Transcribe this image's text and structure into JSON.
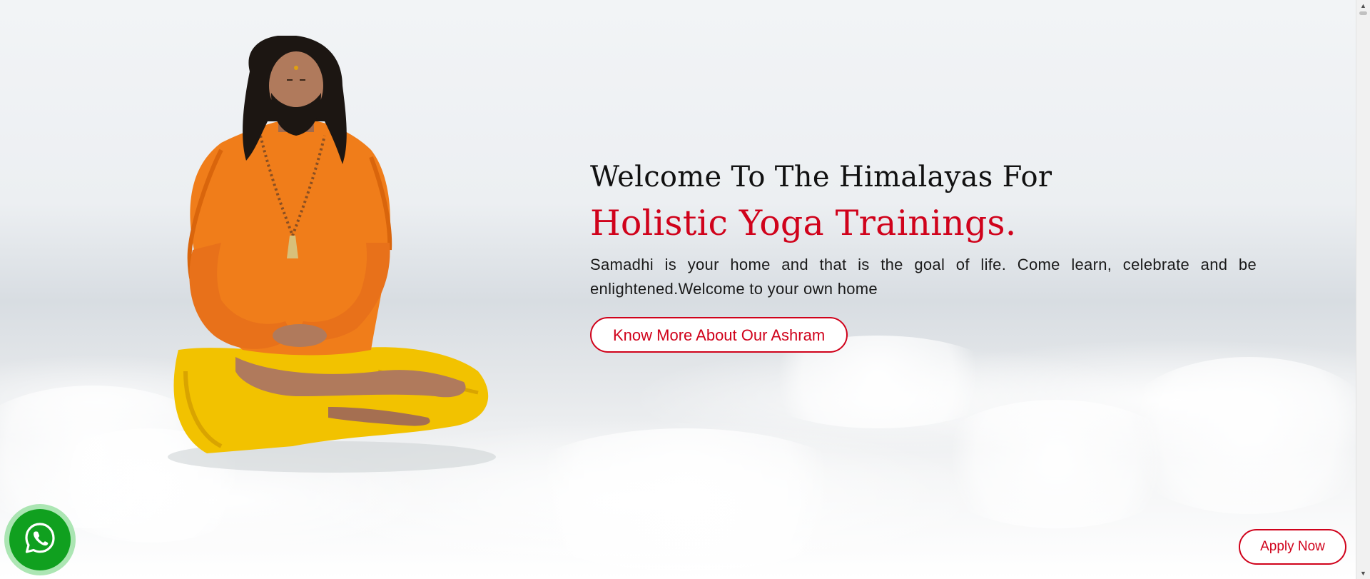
{
  "hero": {
    "welcome_text": "Welcome To The Himalayas For",
    "title_text": "Holistic Yoga Trainings.",
    "description": "Samadhi is your home and that is the goal of life. Come learn, celebrate and be enlightened.Welcome to your own home",
    "cta_label": "Know More About Our Ashram"
  },
  "floating": {
    "apply_label": "Apply Now",
    "whatsapp_icon": "whatsapp-icon"
  },
  "colors": {
    "accent": "#d0021b",
    "whatsapp": "#10a01f"
  }
}
